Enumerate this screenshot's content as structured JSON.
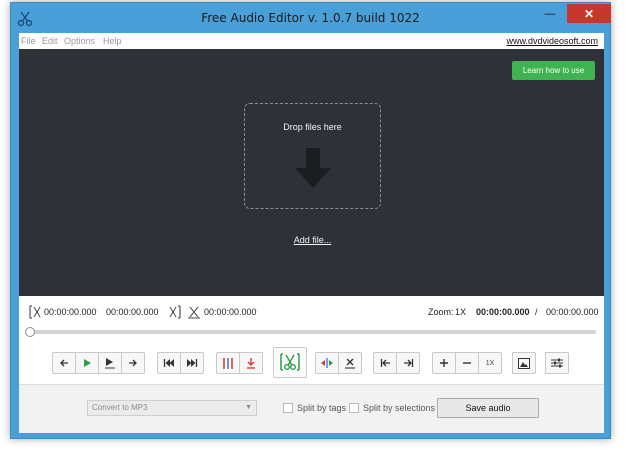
{
  "window": {
    "title": "Free Audio Editor v. 1.0.7 build 1022",
    "controls": {
      "minimize": "—",
      "maximize": "□",
      "close": "✕"
    }
  },
  "menu": {
    "items": [
      "File",
      "Edit",
      "Options",
      "Help"
    ],
    "site_link": "www.dvdvideosoft.com"
  },
  "drop_area": {
    "learn_button": "Learn how to use",
    "drop_text": "Drop files here",
    "add_file": "Add file...",
    "icon": "down-arrow-icon"
  },
  "timeline": {
    "selection_start": "00:00:00.000",
    "selection_end": "00:00:00.000",
    "cut_time": "00:00:00.000",
    "zoom_label": "Zoom:",
    "zoom_value": "1X",
    "current_time": "00:00:00.000",
    "separator": "/",
    "total_time": "00:00:00.000",
    "seek_position": 0
  },
  "toolbar": {
    "speed_label": "1X",
    "groups": [
      [
        "back-arrow-icon",
        "play-icon",
        "play-selection-icon",
        "forward-arrow-icon"
      ],
      [
        "skip-start-icon",
        "skip-end-icon"
      ],
      [
        "split-markers-icon",
        "download-marker-icon"
      ],
      [
        "scissors-cut-icon"
      ],
      [
        "mark-selection-icon",
        "delete-selection-icon"
      ],
      [
        "go-to-start-icon",
        "go-to-end-icon"
      ],
      [
        "zoom-in-icon",
        "zoom-out-icon",
        "zoom-reset-icon"
      ],
      [
        "image-icon"
      ],
      [
        "settings-sliders-icon"
      ]
    ]
  },
  "output": {
    "format": "Convert to MP3",
    "split_by_tags": "Split by tags",
    "split_by_selections": "Split by selections",
    "split_by_tags_checked": false,
    "split_by_selections_checked": false,
    "save_button": "Save audio"
  },
  "colors": {
    "title_bar": "#49a0d8",
    "drop_area_bg": "#2e3138",
    "learn_button": "#3fb34f",
    "play_green": "#2e9e4a",
    "cut_green": "#2e9e4a",
    "split_red": "#d93b3b",
    "close_red": "#c7372b"
  }
}
